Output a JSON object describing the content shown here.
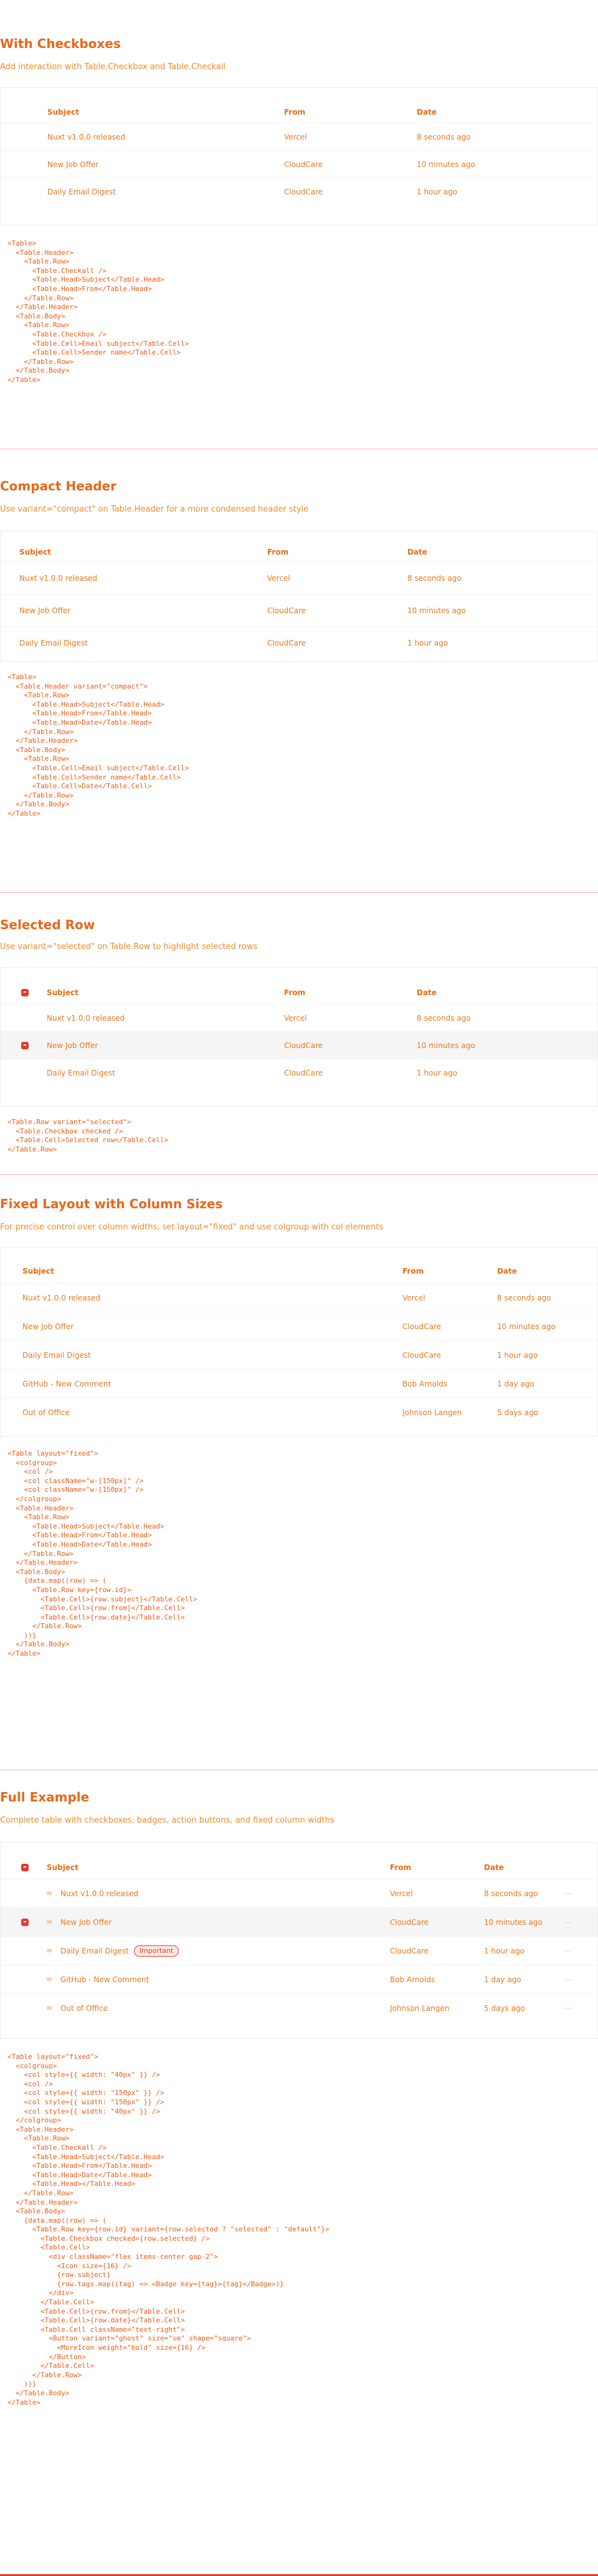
{
  "sections": {
    "checkboxes": {
      "title": "With Checkboxes",
      "desc": "Add interaction with Table.Checkbox and Table.Checkall",
      "headers": [
        "Subject",
        "From",
        "Date"
      ],
      "rows": [
        {
          "subject": "Nuxt v1.0.0 released",
          "from": "Vercel",
          "date": "8 seconds ago"
        },
        {
          "subject": "New Job Offer",
          "from": "CloudCare",
          "date": "10 minutes ago"
        },
        {
          "subject": "Daily Email Digest",
          "from": "CloudCare",
          "date": "1 hour ago"
        }
      ],
      "code": "<Table>\n  <Table.Header>\n    <Table.Row>\n      <Table.Checkall />\n      <Table.Head>Subject</Table.Head>\n      <Table.Head>From</Table.Head>\n    </Table.Row>\n  </Table.Header>\n  <Table.Body>\n    <Table.Row>\n      <Table.Checkbox />\n      <Table.Cell>Email subject</Table.Cell>\n      <Table.Cell>Sender name</Table.Cell>\n    </Table.Row>\n  </Table.Body>\n</Table>"
    },
    "compact": {
      "title": "Compact Header",
      "desc": "Use variant=\"compact\" on Table.Header for a more condensed header style",
      "headers": [
        "Subject",
        "From",
        "Date"
      ],
      "rows": [
        {
          "subject": "Nuxt v1.0.0 released",
          "from": "Vercel",
          "date": "8 seconds ago"
        },
        {
          "subject": "New Job Offer",
          "from": "CloudCare",
          "date": "10 minutes ago"
        },
        {
          "subject": "Daily Email Digest",
          "from": "CloudCare",
          "date": "1 hour ago"
        }
      ],
      "code": "<Table>\n  <Table.Header variant=\"compact\">\n    <Table.Row>\n      <Table.Head>Subject</Table.Head>\n      <Table.Head>From</Table.Head>\n      <Table.Head>Date</Table.Head>\n    </Table.Row>\n  </Table.Header>\n  <Table.Body>\n    <Table.Row>\n      <Table.Cell>Email subject</Table.Cell>\n      <Table.Cell>Sender name</Table.Cell>\n      <Table.Cell>Date</Table.Cell>\n    </Table.Row>\n  </Table.Body>\n</Table>"
    },
    "selected": {
      "title": "Selected Row",
      "desc": "Use variant=\"selected\" on Table.Row to highlight selected rows",
      "headers": [
        "Subject",
        "From",
        "Date"
      ],
      "rows": [
        {
          "subject": "Nuxt v1.0.0 released",
          "from": "Vercel",
          "date": "8 seconds ago",
          "selected": false,
          "checked": false
        },
        {
          "subject": "New Job Offer",
          "from": "CloudCare",
          "date": "10 minutes ago",
          "selected": true,
          "checked": true
        },
        {
          "subject": "Daily Email Digest",
          "from": "CloudCare",
          "date": "1 hour ago",
          "selected": false,
          "checked": false
        }
      ],
      "code": "<Table.Row variant=\"selected\">\n  <Table.Checkbox checked />\n  <Table.Cell>Selected row</Table.Cell>\n</Table.Row>"
    },
    "fixed": {
      "title": "Fixed Layout with Column Sizes",
      "desc": "For precise control over column widths, set layout=\"fixed\" and use colgroup with col elements",
      "headers": [
        "Subject",
        "From",
        "Date"
      ],
      "rows": [
        {
          "subject": "Nuxt v1.0.0 released",
          "from": "Vercel",
          "date": "8 seconds ago"
        },
        {
          "subject": "New Job Offer",
          "from": "CloudCare",
          "date": "10 minutes ago"
        },
        {
          "subject": "Daily Email Digest",
          "from": "CloudCare",
          "date": "1 hour ago"
        },
        {
          "subject": "GitHub - New Comment",
          "from": "Bob Arnolds",
          "date": "1 day ago"
        },
        {
          "subject": "Out of Office",
          "from": "Johnson Langen",
          "date": "5 days ago"
        }
      ],
      "code": "<Table layout=\"fixed\">\n  <colgroup>\n    <col />\n    <col className=\"w-[150px]\" />\n    <col className=\"w-[150px]\" />\n  </colgroup>\n  <Table.Header>\n    <Table.Row>\n      <Table.Head>Subject</Table.Head>\n      <Table.Head>From</Table.Head>\n      <Table.Head>Date</Table.Head>\n    </Table.Row>\n  </Table.Header>\n  <Table.Body>\n    {data.map((row) => (\n      <Table.Row key={row.id}>\n        <Table.Cell>{row.subject}</Table.Cell>\n        <Table.Cell>{row.from}</Table.Cell>\n        <Table.Cell>{row.date}</Table.Cell>\n      </Table.Row>\n    ))}\n  </Table.Body>\n</Table>"
    },
    "full": {
      "title": "Full Example",
      "desc": "Complete table with checkboxes, badges, action buttons, and fixed column widths",
      "headers": [
        "Subject",
        "From",
        "Date"
      ],
      "badge": "Important",
      "rows": [
        {
          "subject": "Nuxt v1.0.0 released",
          "from": "Vercel",
          "date": "8 seconds ago",
          "selected": false,
          "checked": false,
          "badge": false
        },
        {
          "subject": "New Job Offer",
          "from": "CloudCare",
          "date": "10 minutes ago",
          "selected": true,
          "checked": true,
          "badge": false
        },
        {
          "subject": "Daily Email Digest",
          "from": "CloudCare",
          "date": "1 hour ago",
          "selected": false,
          "checked": false,
          "badge": true
        },
        {
          "subject": "GitHub - New Comment",
          "from": "Bob Arnolds",
          "date": "1 day ago",
          "selected": false,
          "checked": false,
          "badge": false
        },
        {
          "subject": "Out of Office",
          "from": "Johnson Langen",
          "date": "5 days ago",
          "selected": false,
          "checked": false,
          "badge": false
        }
      ],
      "row_action": "⋯",
      "code": "<Table layout=\"fixed\">\n  <colgroup>\n    <col style={{ width: \"40px\" }} />\n    <col />\n    <col style={{ width: \"150px\" }} />\n    <col style={{ width: \"150px\" }} />\n    <col style={{ width: \"40px\" }} />\n  </colgroup>\n  <Table.Header>\n    <Table.Row>\n      <Table.Checkall />\n      <Table.Head>Subject</Table.Head>\n      <Table.Head>From</Table.Head>\n      <Table.Head>Date</Table.Head>\n      <Table.Head></Table.Head>\n    </Table.Row>\n  </Table.Header>\n  <Table.Body>\n    {data.map((row) => (\n      <Table.Row key={row.id} variant={row.selected ? \"selected\" : \"default\"}>\n        <Table.Checkbox checked={row.selected} />\n        <Table.Cell>\n          <div className=\"flex items-center gap-2\">\n            <Icon size={16} />\n            {row.subject}\n            {row.tags.map((tag) => <Badge key={tag}>{tag}</Badge>)}\n          </div>\n        </Table.Cell>\n        <Table.Cell>{row.from}</Table.Cell>\n        <Table.Cell>{row.date}</Table.Cell>\n        <Table.Cell className=\"text-right\">\n          <Button variant=\"ghost\" size=\"sm\" shape=\"square\">\n            <MoreIcon weight=\"bold\" size={16} />\n          </Button>\n        </Table.Cell>\n      </Table.Row>\n    ))}\n  </Table.Body>\n</Table>"
    }
  }
}
